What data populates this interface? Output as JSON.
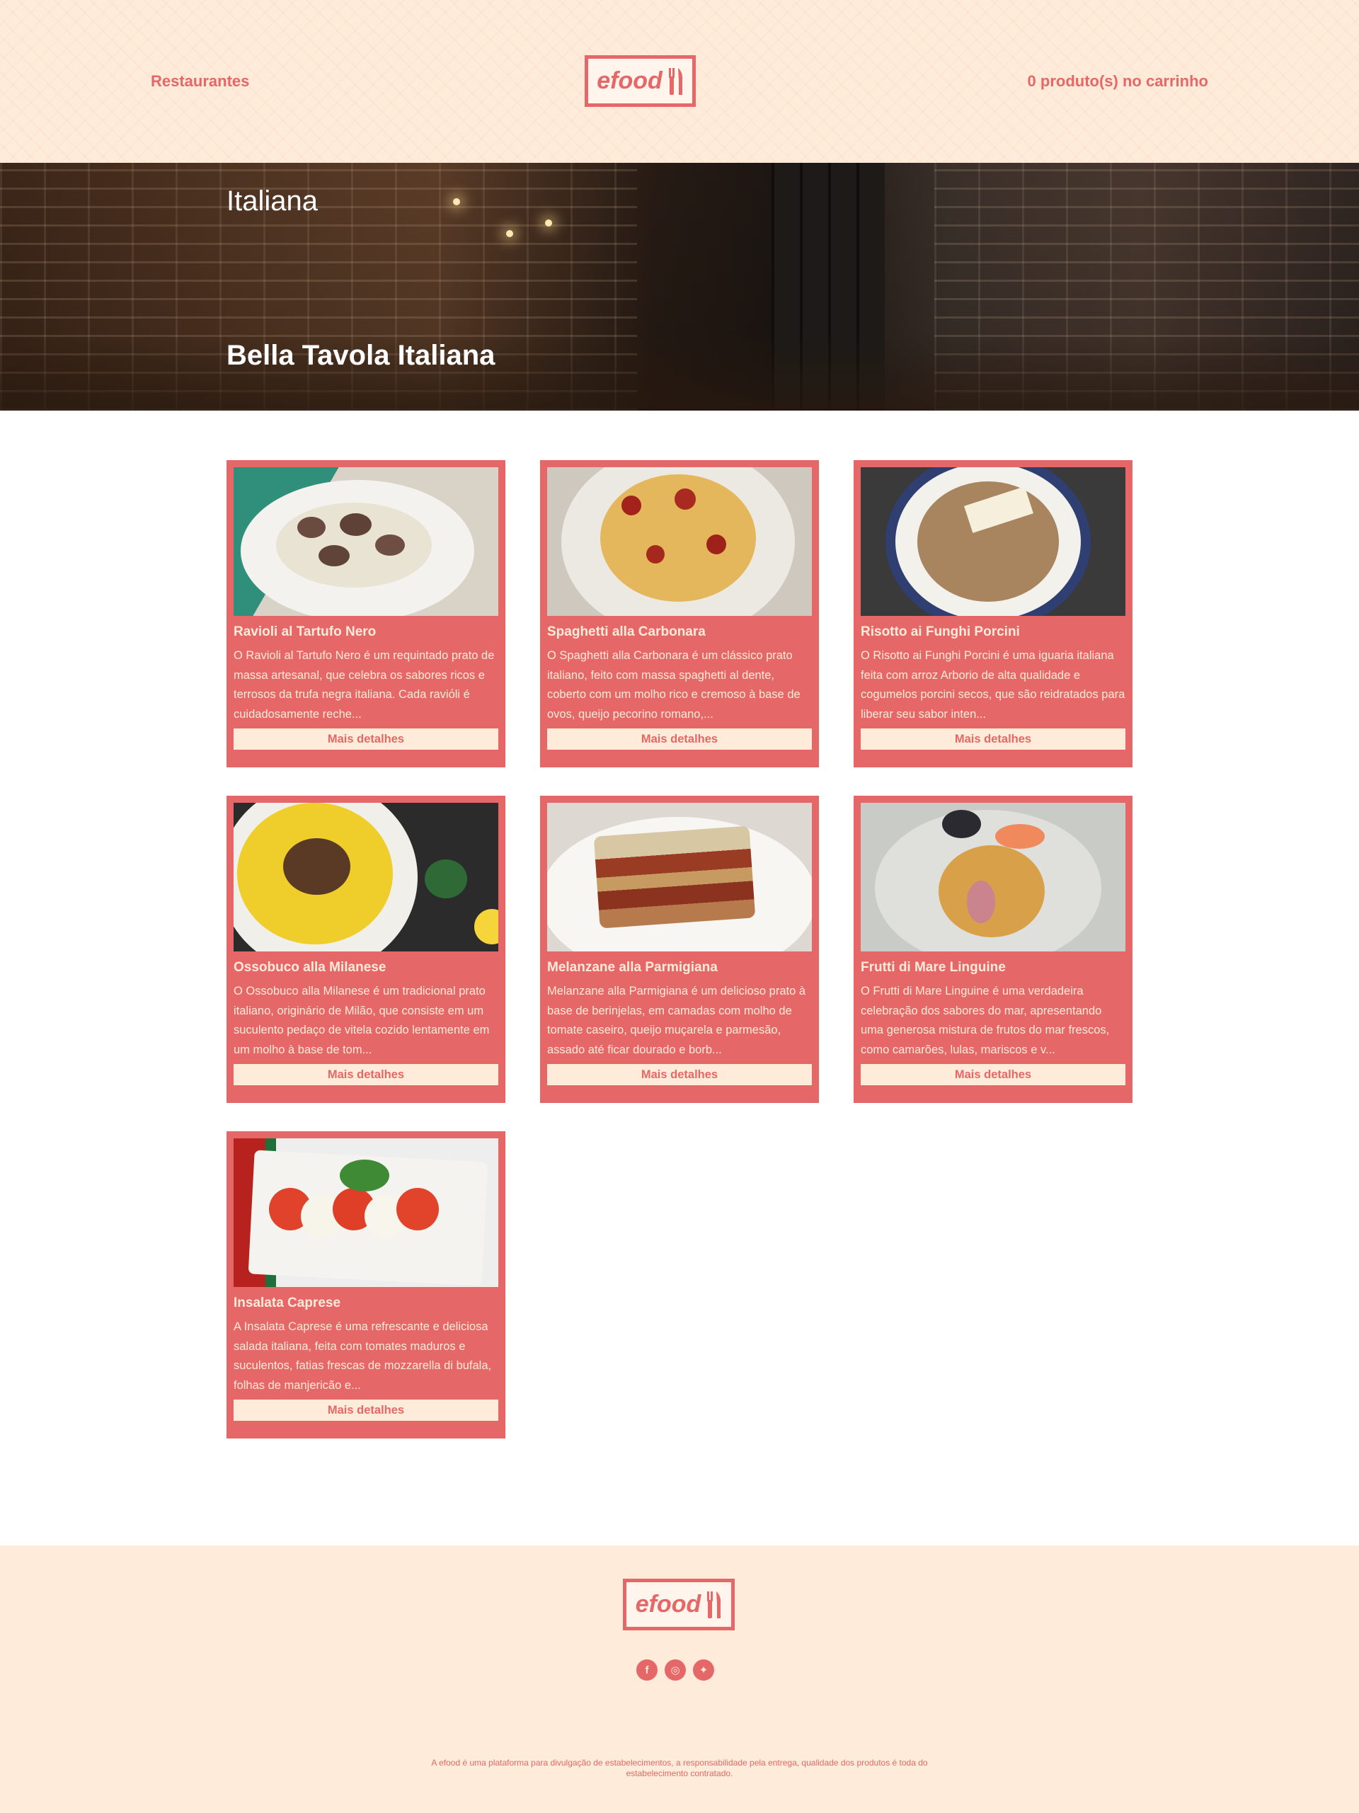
{
  "header": {
    "nav_restaurants": "Restaurantes",
    "logo_text": "efood",
    "cart_label": "0 produto(s) no carrinho"
  },
  "hero": {
    "category": "Italiana",
    "restaurant_name": "Bella Tavola Italiana"
  },
  "menu": {
    "items": [
      {
        "title": "Ravioli al Tartufo Nero",
        "description": "O Ravioli al Tartufo Nero é um requintado prato de massa artesanal, que celebra os sabores ricos e terrosos da trufa negra italiana. Cada raviόli é cuidadosamente reche...",
        "button": "Mais detalhes",
        "photo": "ravioli-photo"
      },
      {
        "title": "Spaghetti alla Carbonara",
        "description": "O Spaghetti alla Carbonara é um clássico prato italiano, feito com massa spaghetti al dente, coberto com um molho rico e cremoso à base de ovos, queijo pecorino romano,...",
        "button": "Mais detalhes",
        "photo": "carbonara-photo"
      },
      {
        "title": "Risotto ai Funghi Porcini",
        "description": "O Risotto ai Funghi Porcini é uma iguaria italiana feita com arroz Arborio de alta qualidade e cogumelos porcini secos, que são reidratados para liberar seu sabor inten...",
        "button": "Mais detalhes",
        "photo": "risotto-photo"
      },
      {
        "title": "Ossobuco alla Milanese",
        "description": "O Ossobuco alla Milanese é um tradicional prato italiano, originário de Milão, que consiste em um suculento pedaço de vitela cozido lentamente em um molho à base de tom...",
        "button": "Mais detalhes",
        "photo": "ossobuco-photo"
      },
      {
        "title": "Melanzane alla Parmigiana",
        "description": "Melanzane alla Parmigiana é um delicioso prato à base de berinjelas, em camadas com molho de tomate caseiro, queijo muçarela e parmesão, assado até ficar dourado e borb...",
        "button": "Mais detalhes",
        "photo": "parmigiana-photo"
      },
      {
        "title": "Frutti di Mare Linguine",
        "description": "O Frutti di Mare Linguine é uma verdadeira celebração dos sabores do mar, apresentando uma generosa mistura de frutos do mar frescos, como camarões, lulas, mariscos e v...",
        "button": "Mais detalhes",
        "photo": "linguine-photo"
      },
      {
        "title": "Insalata Caprese",
        "description": "A Insalata Caprese é uma refrescante e deliciosa salada italiana, feita com tomates maduros e suculentos, fatias frescas de mozzarella di bufala, folhas de manjericão e...",
        "button": "Mais detalhes",
        "photo": "caprese-photo"
      }
    ]
  },
  "footer": {
    "logo_text": "efood",
    "socials": [
      {
        "icon": "facebook-icon",
        "glyph": "f"
      },
      {
        "icon": "instagram-icon",
        "glyph": "◎"
      },
      {
        "icon": "twitter-icon",
        "glyph": "✦"
      }
    ],
    "note": "A efood é uma plataforma para divulgação de estabelecimentos, a responsabilidade pela entrega, qualidade dos produtos é toda do estabelecimento contratado."
  },
  "colors": {
    "brand": "#E66767",
    "cream": "#FFEBD9",
    "page": "#FFFFFF"
  }
}
